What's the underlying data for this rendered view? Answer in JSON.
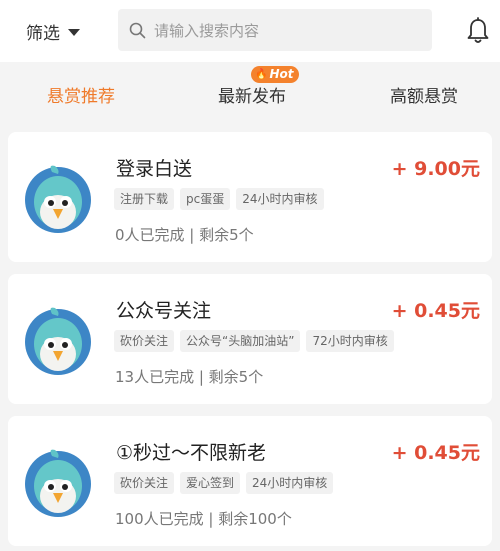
{
  "header": {
    "filter_label": "筛选",
    "search_placeholder": "请输入搜索内容"
  },
  "tabs": [
    {
      "label": "悬赏推荐",
      "active": true
    },
    {
      "label": "最新发布",
      "active": false,
      "badge": "Hot"
    },
    {
      "label": "高额悬赏",
      "active": false
    }
  ],
  "colors": {
    "accent": "#ef7a2a",
    "reward": "#e04d37",
    "hot_badge": "#f4822d",
    "avatar_ring": "#3d86c6"
  },
  "tasks": [
    {
      "title": "登录白送",
      "reward": "+ 9.00元",
      "tags": [
        "注册下载",
        "pc蛋蛋",
        "24小时内审核"
      ],
      "status": "0人已完成 | 剩余5个"
    },
    {
      "title": "公众号关注",
      "reward": "+ 0.45元",
      "tags": [
        "砍价关注",
        "公众号“头脑加油站”",
        "72小时内审核"
      ],
      "status": "13人已完成 | 剩余5个"
    },
    {
      "title": "①秒过～不限新老",
      "reward": "+ 0.45元",
      "tags": [
        "砍价关注",
        "爱心签到",
        "24小时内审核"
      ],
      "status": "100人已完成 | 剩余100个"
    }
  ]
}
